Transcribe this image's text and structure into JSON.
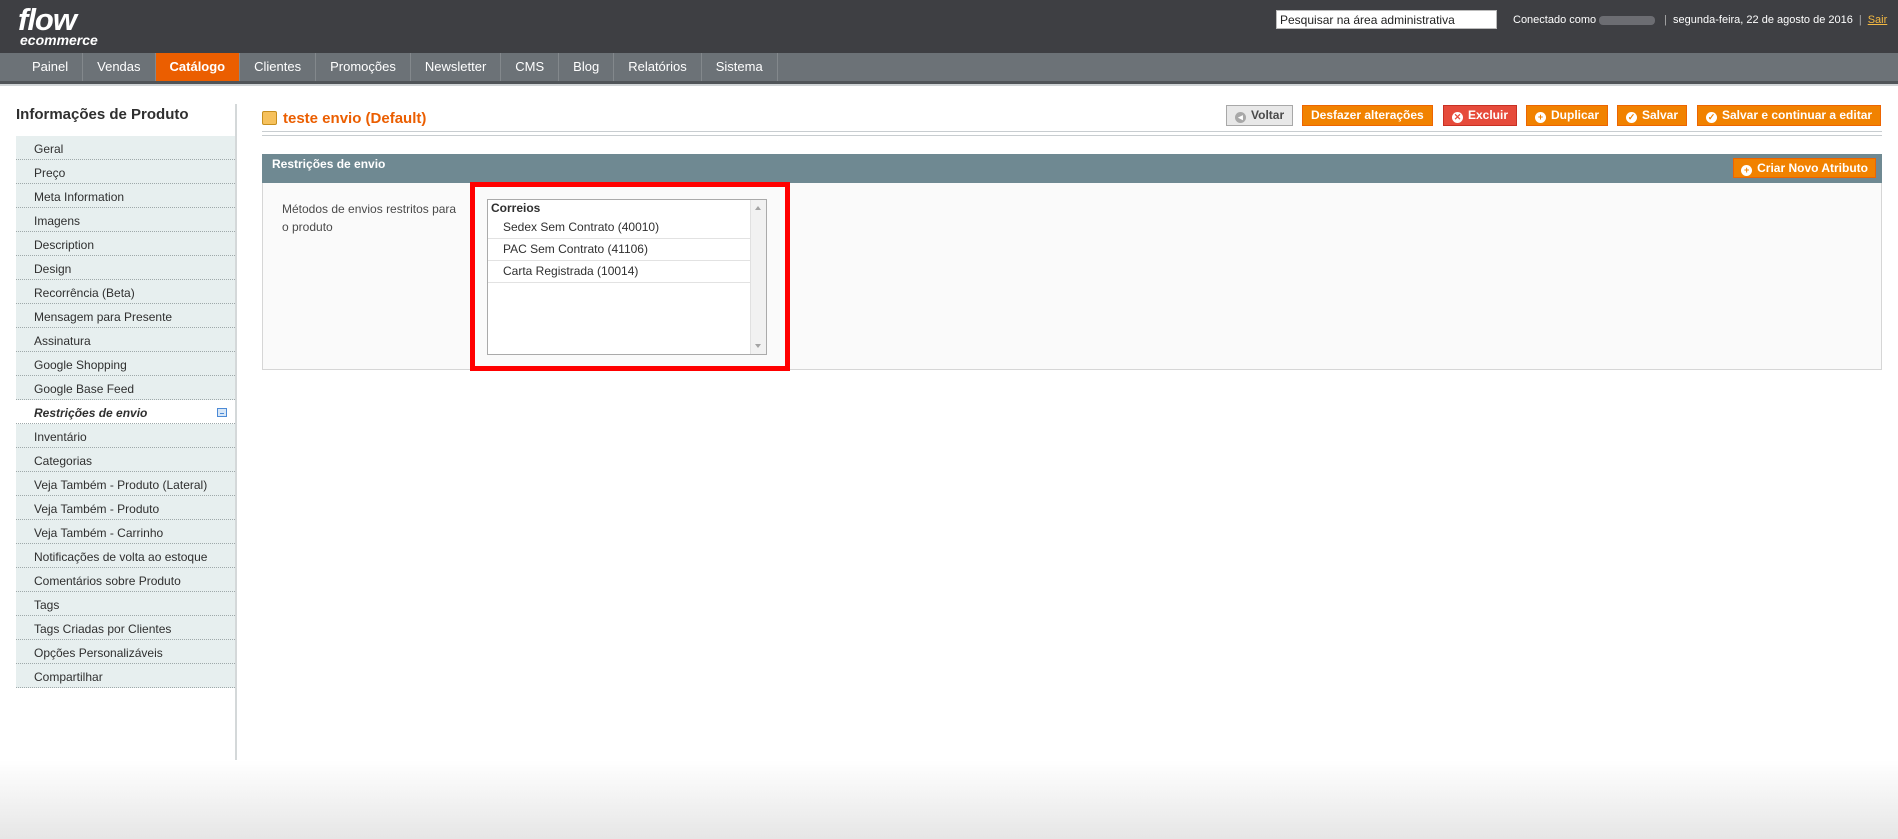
{
  "logo": {
    "line1": "flow",
    "line2": "ecommerce"
  },
  "header": {
    "search_value": "Pesquisar na área administrativa",
    "connected_as": "Conectado como",
    "date": "segunda-feira, 22 de agosto de 2016",
    "logout": "Sair"
  },
  "nav": [
    "Painel",
    "Vendas",
    "Catálogo",
    "Clientes",
    "Promoções",
    "Newsletter",
    "CMS",
    "Blog",
    "Relatórios",
    "Sistema"
  ],
  "nav_active": "Catálogo",
  "sidebar": {
    "title": "Informações de Produto",
    "tabs": [
      "Geral",
      "Preço",
      "Meta Information",
      "Imagens",
      "Description",
      "Design",
      "Recorrência (Beta)",
      "Mensagem para Presente",
      "Assinatura",
      "Google Shopping",
      "Google Base Feed",
      "Restrições de envio",
      "Inventário",
      "Categorias",
      "Veja Também - Produto (Lateral)",
      "Veja Também - Produto",
      "Veja Também - Carrinho",
      "Notificações de volta ao estoque",
      "Comentários sobre Produto",
      "Tags",
      "Tags Criadas por Clientes",
      "Opções Personalizáveis",
      "Compartilhar"
    ],
    "active_tab": "Restrições de envio"
  },
  "page": {
    "title": "teste envio (Default)"
  },
  "buttons": {
    "back": "Voltar",
    "reset": "Desfazer alterações",
    "delete": "Excluir",
    "duplicate": "Duplicar",
    "save": "Salvar",
    "save_continue": "Salvar e continuar a editar"
  },
  "fieldset": {
    "title": "Restrições de envio",
    "new_attribute": "Criar Novo Atributo",
    "label": "Métodos de envios restritos para o produto",
    "group": "Correios",
    "options": [
      "Sedex Sem Contrato (40010)",
      "PAC Sem Contrato (41106)",
      "Carta Registrada (10014)"
    ]
  },
  "colors": {
    "accent": "#eb5e00",
    "button": "#f18200",
    "highlight": "#ff0000",
    "fieldset_header": "#6f8992"
  }
}
